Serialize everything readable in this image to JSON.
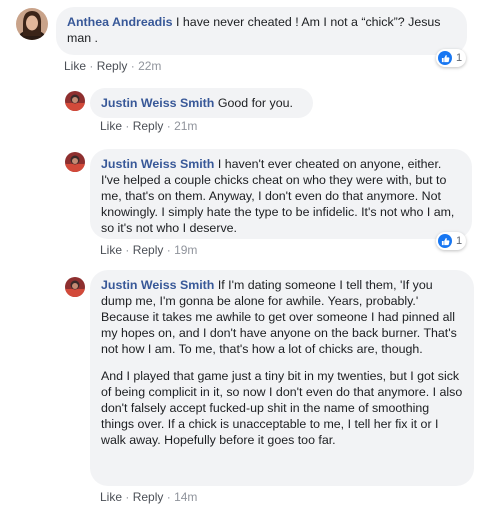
{
  "comments": [
    {
      "author": "Anthea Andreadis",
      "text": "I have never cheated ! Am I not a “chick”? Jesus man .",
      "actions": {
        "like": "Like",
        "reply": "Reply",
        "time": "22m"
      },
      "reaction_count": "1"
    },
    {
      "author": "Justin Weiss Smith",
      "text": "Good for you.",
      "actions": {
        "like": "Like",
        "reply": "Reply",
        "time": "21m"
      }
    },
    {
      "author": "Justin Weiss Smith",
      "text": "I haven't ever cheated on anyone, either. I've helped a couple chicks cheat on who they were with, but to me, that's on them. Anyway, I don't even do that anymore. Not knowingly. I simply hate the type to be infidelic. It's not who I am, so it's not who I deserve.",
      "actions": {
        "like": "Like",
        "reply": "Reply",
        "time": "19m"
      },
      "reaction_count": "1"
    },
    {
      "author": "Justin Weiss Smith",
      "text": "If I'm dating someone I tell them, 'If you dump me, I'm gonna be alone for awhile. Years, probably.' Because it takes me awhile to get over someone I had pinned all my hopes on, and I don't have anyone on the back burner. That's not how I am. To me, that's how a lot of chicks are, though.",
      "text2": "And I played that game just a tiny bit in my twenties, but I got sick of being complicit in it, so now I don't even do that anymore. I also don't falsely accept fucked-up shit in the name of smoothing things over. If a chick is unacceptable to me, I tell her fix it or I walk away. Hopefully before it goes too far.",
      "actions": {
        "like": "Like",
        "reply": "Reply",
        "time": "14m"
      }
    }
  ],
  "colors": {
    "author": "#385898",
    "bubble": "#f2f3f5",
    "like_badge": "#1877f2",
    "meta": "#90949c"
  },
  "icons": {
    "reaction": "thumbs-up-icon",
    "avatar": "profile-photo"
  }
}
